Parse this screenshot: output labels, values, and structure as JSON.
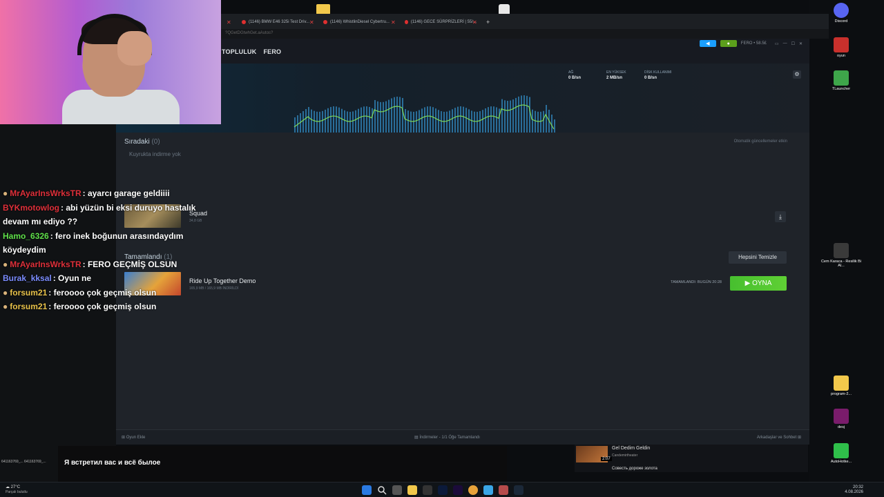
{
  "browser": {
    "tabs": [
      {
        "label": "(1146) BMW E46 325i Test Driv..."
      },
      {
        "label": "(1146) WhistlinDiesel Cybertru..."
      },
      {
        "label": "(1146) GECE SÜRPRİZLERİ | 55/..."
      }
    ],
    "address": "?QGetDGtwhGet.aAutos?"
  },
  "steam": {
    "nav": [
      "TOPLULUK",
      "FERO"
    ],
    "user_label": "FERO • 58.5£",
    "stats": [
      {
        "label": "AĞ",
        "value": "0 B/sn"
      },
      {
        "label": "EN YÜKSEK",
        "value": "2 MB/sn"
      },
      {
        "label": "DİSK KULLANIMI",
        "value": "0 B/sn"
      }
    ],
    "queue": {
      "title": "Sıradaki",
      "count": "(0)",
      "empty_text": "Kuyrukta indirme yok",
      "auto_updates": "Otomatik güncellemeler etkin"
    },
    "scheduled": {
      "name": "Squad",
      "size": "34,8 GB"
    },
    "completed": {
      "title": "Tamamlandı",
      "count": "(1)",
      "clear_label": "Hepsini Temizle",
      "game_name": "Ride Up Together Demo",
      "game_size": "165,9 MB / 165,9 MB İNDİRİLDİ",
      "completed_text": "TAMAMLANDI: BUGÜN 20:28",
      "play_label": "OYNA"
    },
    "footer": {
      "add_game": "Oyun Ekle",
      "downloads": "İndirmeler - 1/1 Öğe Tamamlandı",
      "friends": "Arkadaşlar ve Sohbet"
    }
  },
  "chat": [
    {
      "user": "MrAyarInsWrksTR",
      "color": "#e0303a",
      "badge": true,
      "text": ": ayarcı garage geldiiii"
    },
    {
      "user": "BYKmotowlog",
      "color": "#e0303a",
      "badge": false,
      "text": ": abi yüzün bi eksi duruyo hastalık devam mı ediyo ??"
    },
    {
      "user": "Hamo_6326",
      "color": "#5fe04a",
      "badge": false,
      "text": ": fero inek boğunun arasındaydım köydeydim"
    },
    {
      "user": "MrAyarInsWrksTR",
      "color": "#e0303a",
      "badge": true,
      "text": ": FERO GEÇMİŞ OLSUN"
    },
    {
      "user": "Burak_kksal",
      "color": "#7b8cff",
      "badge": false,
      "text": ": Oyun ne"
    },
    {
      "user": "forsum21",
      "color": "#e8c24a",
      "badge": true,
      "text": ": feroooo çok geçmiş olsun"
    },
    {
      "user": "forsum21",
      "color": "#e8c24a",
      "badge": true,
      "text": ": feroooo çok geçmiş olsun"
    }
  ],
  "overlay": {
    "subtitle": "Я встретил вас и всё былое",
    "left_small": "641163769_... 641163769_..."
  },
  "song_widget": {
    "title": "Gel Dedim Geldin",
    "artist": "Candemirtheater",
    "time": "2:07",
    "next": "Совесть дороже золота"
  },
  "desktop_icons": [
    {
      "label": "Discord"
    },
    {
      "label": "oyun"
    },
    {
      "label": "TLauncher"
    },
    {
      "label": "Cem Karaca - Resilik Bi Al..."
    },
    {
      "label": "program-2..."
    },
    {
      "label": "desj"
    },
    {
      "label": "AutoHotke..."
    }
  ],
  "taskbar": {
    "weather_temp": "27°C",
    "weather_desc": "Parçalı bulutlu",
    "time": "20:32",
    "date": "4.08.2026"
  }
}
